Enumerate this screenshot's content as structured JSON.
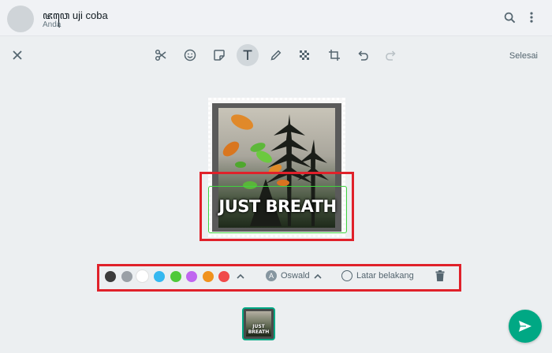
{
  "header": {
    "chat_name": "ꦗꦮꦺ uji coba",
    "chat_subtitle": "Anda",
    "icons": [
      "search-icon",
      "menu-icon"
    ]
  },
  "toolbar": {
    "close_icon": "close-icon",
    "tools": [
      {
        "name": "crop-cut",
        "icon": "scissors-icon"
      },
      {
        "name": "emoji",
        "icon": "emoji-icon"
      },
      {
        "name": "sticker",
        "icon": "sticker-icon"
      },
      {
        "name": "text",
        "icon": "text-icon",
        "active": true
      },
      {
        "name": "draw",
        "icon": "pen-icon"
      },
      {
        "name": "blur",
        "icon": "blur-icon"
      },
      {
        "name": "crop-rotate",
        "icon": "crop-icon"
      },
      {
        "name": "undo",
        "icon": "undo-icon"
      },
      {
        "name": "redo",
        "icon": "redo-icon"
      }
    ],
    "done_label": "Selesai"
  },
  "editor": {
    "caption_text": "JUST BREATH"
  },
  "text_options": {
    "colors": [
      "#3b3b3b",
      "#9aa0a6",
      "#ffffff",
      "#35b8f0",
      "#4fc93a",
      "#c066f0",
      "#f0921e",
      "#f04a4a"
    ],
    "font_name": "Oswald",
    "background_label": "Latar belakang"
  },
  "thumbnail": {
    "caption_text": "JUST BREATH"
  },
  "colors": {
    "accent": "#00a884",
    "highlight_border": "#e0212a"
  }
}
